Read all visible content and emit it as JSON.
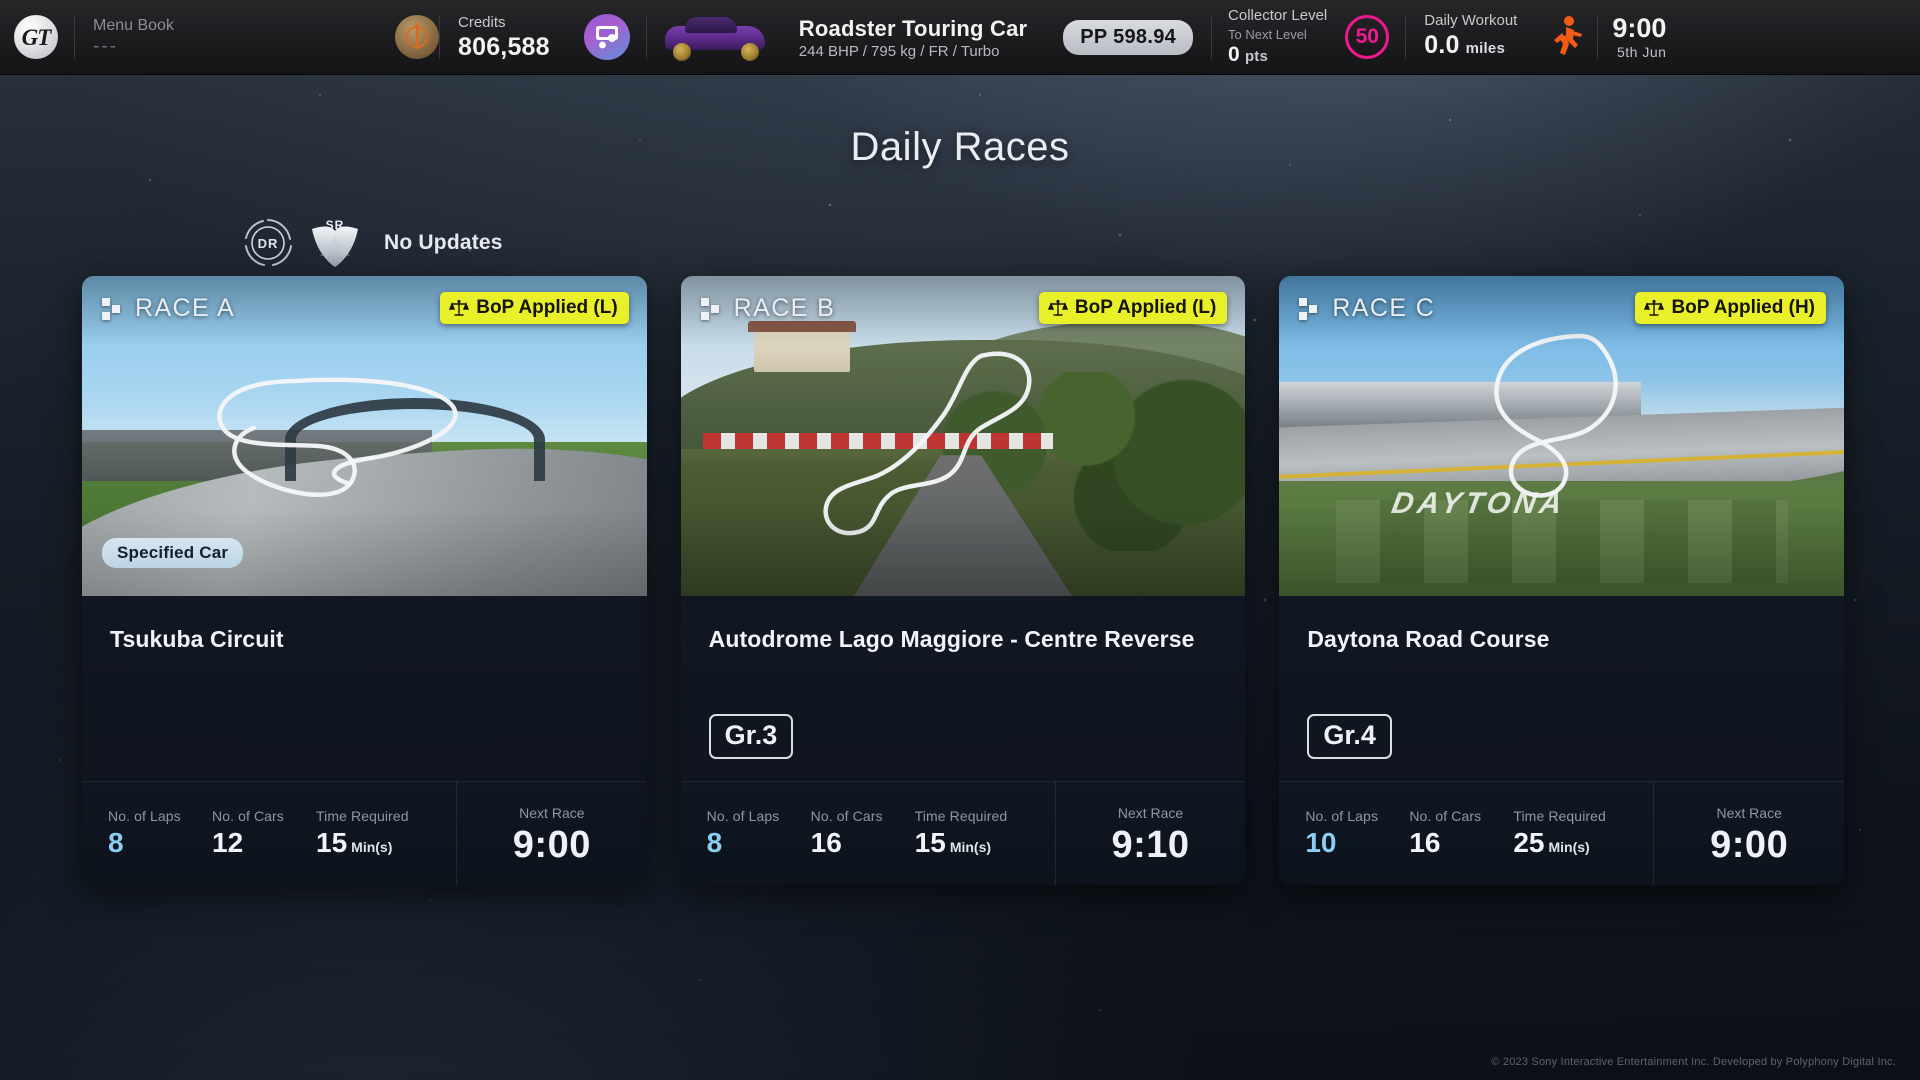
{
  "header": {
    "logo_text": "GT",
    "menu_book": {
      "label": "Menu Book",
      "value": "---"
    },
    "credits": {
      "label": "Credits",
      "value": "806,588"
    },
    "car": {
      "name": "Roadster Touring Car",
      "specs": "244 BHP / 795 kg / FR / Turbo",
      "pp": "PP 598.94"
    },
    "collector": {
      "label": "Collector Level",
      "sub": "To Next Level",
      "points": "0",
      "points_unit": "pts",
      "level": "50"
    },
    "workout": {
      "label": "Daily Workout",
      "value": "0.0",
      "unit": "miles"
    },
    "clock": {
      "time": "9:00",
      "date": "5th Jun"
    }
  },
  "page": {
    "title": "Daily Races"
  },
  "rating": {
    "dr_label": "DR",
    "sr_label": "SR",
    "status": "No Updates"
  },
  "stat_labels": {
    "laps": "No. of Laps",
    "cars": "No. of Cars",
    "time": "Time Required",
    "time_unit": "Min(s)",
    "next": "Next Race"
  },
  "races": [
    {
      "tag": "RACE A",
      "bop": "BoP Applied (L)",
      "pill": "Specified Car",
      "track": "Tsukuba Circuit",
      "group": "",
      "laps": "8",
      "cars": "12",
      "time": "15",
      "next_race": "9:00"
    },
    {
      "tag": "RACE B",
      "bop": "BoP Applied (L)",
      "pill": "",
      "track": "Autodrome Lago Maggiore - Centre Reverse",
      "group": "Gr.3",
      "laps": "8",
      "cars": "16",
      "time": "15",
      "next_race": "9:10"
    },
    {
      "tag": "RACE C",
      "bop": "BoP Applied (H)",
      "pill": "",
      "track": "Daytona Road Course",
      "group": "Gr.4",
      "laps": "10",
      "cars": "16",
      "time": "25",
      "next_race": "9:00"
    }
  ],
  "footer": {
    "copyright": "© 2023 Sony Interactive Entertainment Inc. Developed by Polyphony Digital Inc."
  },
  "colors": {
    "accent_blue": "#8ccdf2",
    "bop_yellow": "#e9f02a",
    "collector_pink": "#f0198f",
    "workout_orange": "#f25a16"
  }
}
